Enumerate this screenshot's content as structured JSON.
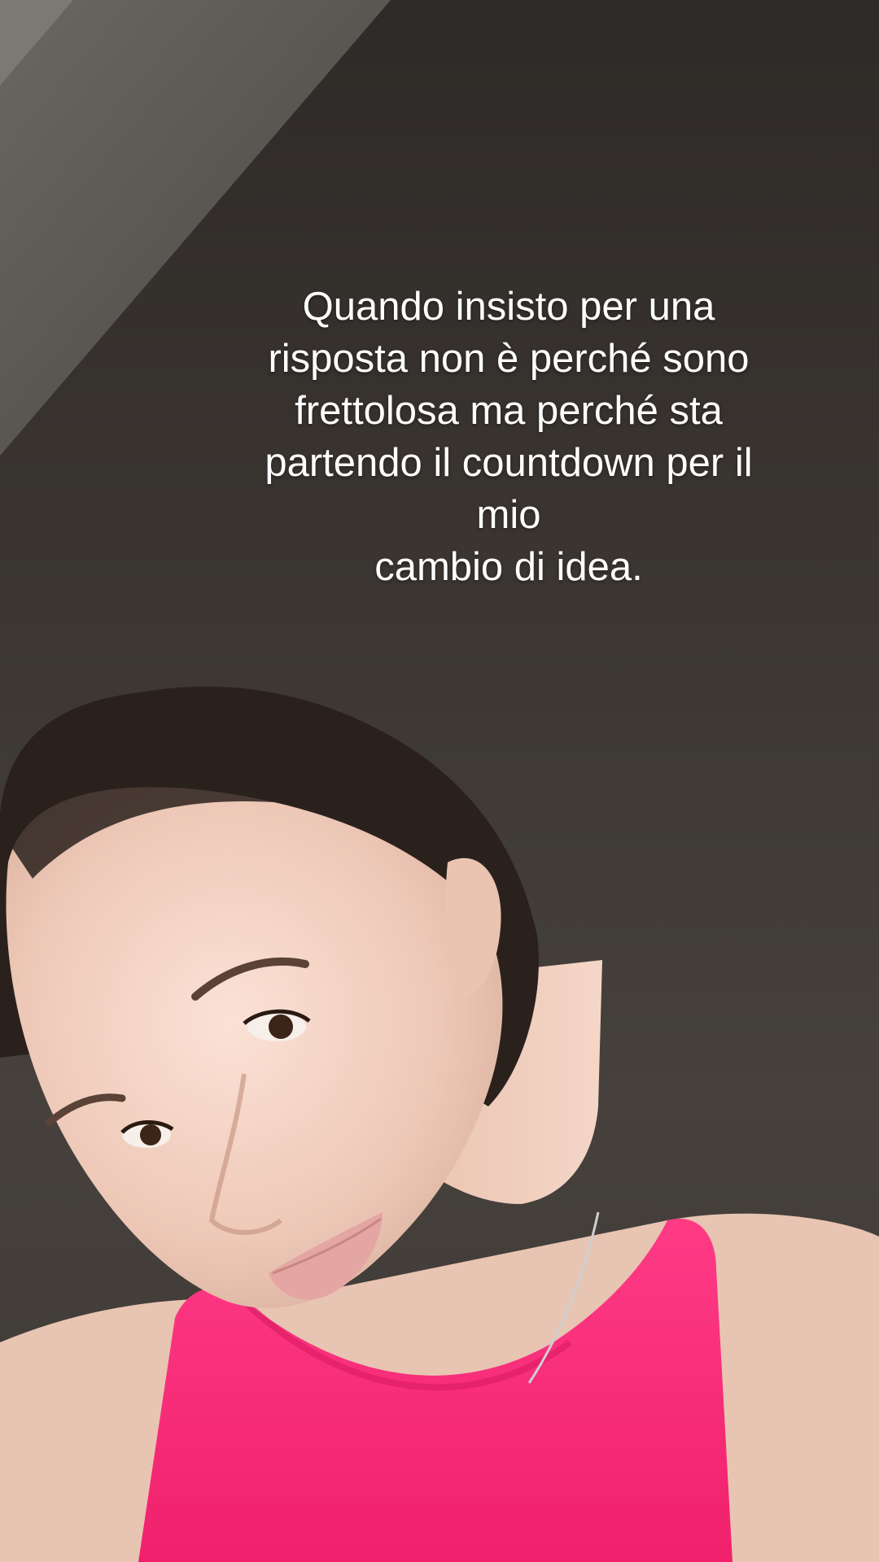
{
  "caption": {
    "lines": [
      "Quando insisto per una",
      "risposta non è perché sono",
      "frettolosa ma perché sta",
      "partendo il countdown per il",
      "mio",
      "cambio di idea."
    ]
  },
  "colors": {
    "wall": "#3b3733",
    "ceiling_light": "#5c5954",
    "top": "#ff2d7a",
    "skin": "#f2d3c4",
    "hair": "#2a211c"
  }
}
